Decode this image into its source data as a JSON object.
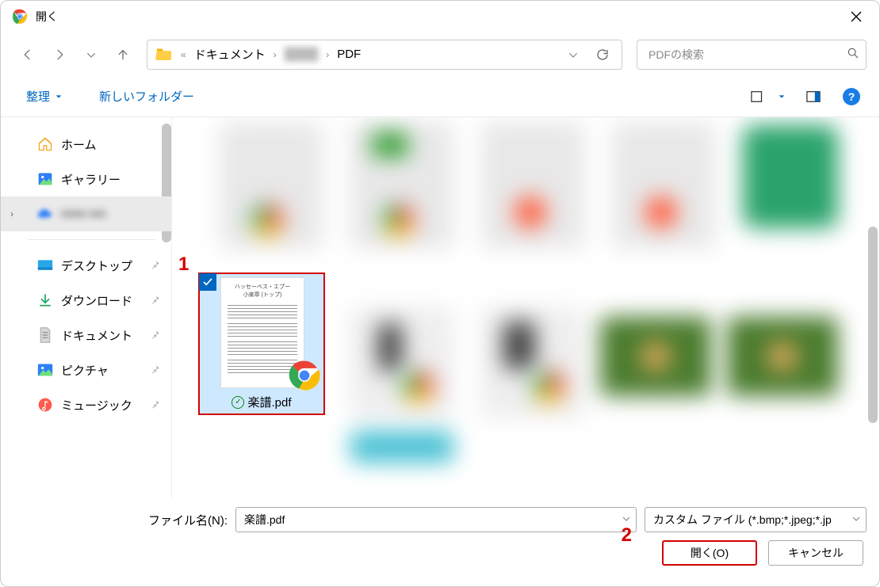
{
  "window": {
    "title": "開く"
  },
  "path": {
    "segs": [
      "ドキュメント",
      "",
      "PDF"
    ]
  },
  "search": {
    "placeholder": "PDFの検索"
  },
  "toolbar": {
    "organize": "整理",
    "new_folder": "新しいフォルダー",
    "help": "?"
  },
  "sidebar": {
    "home": "ホーム",
    "gallery": "ギャラリー",
    "hidden": "•••••• ••••",
    "desktop": "デスクトップ",
    "downloads": "ダウンロード",
    "documents": "ドキュメント",
    "pictures": "ピクチャ",
    "music": "ミュージック"
  },
  "selected_file": {
    "name": "楽譜.pdf"
  },
  "footer": {
    "filename_label": "ファイル名(N):",
    "filename_value": "楽譜.pdf",
    "filetype_text": "カスタム ファイル (*.bmp;*.jpeg;*.jp",
    "open": "開く(O)",
    "cancel": "キャンセル"
  },
  "callouts": {
    "one": "1",
    "two": "2"
  }
}
